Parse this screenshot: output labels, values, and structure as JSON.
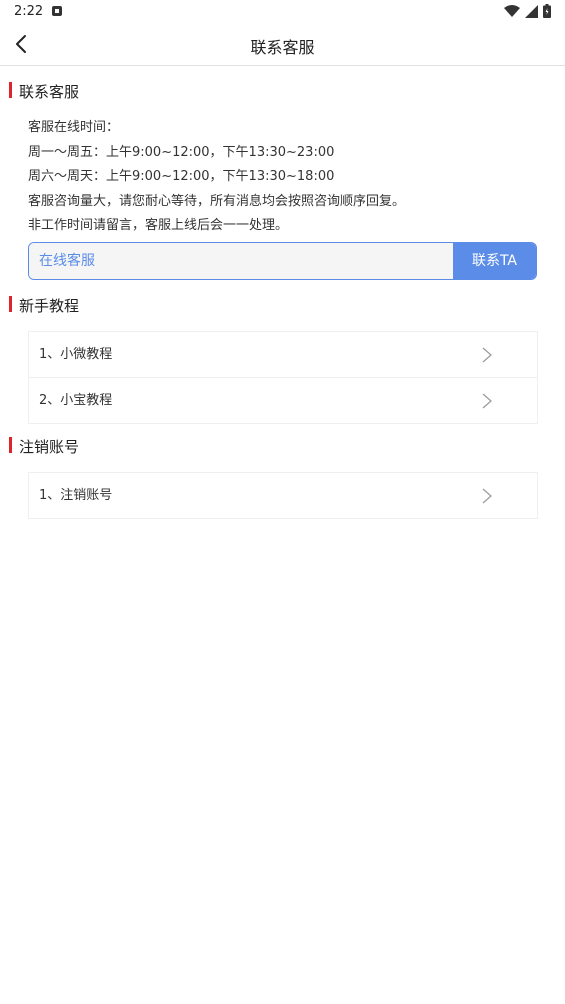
{
  "status": {
    "time": "2:22"
  },
  "nav": {
    "title": "联系客服"
  },
  "contact_section": {
    "title": "联系客服",
    "lines": [
      "客服在线时间：",
      "周一～周五：上午9:00~12:00，下午13:30~23:00",
      "周六～周天：上午9:00~12:00，下午13:30~18:00",
      "客服咨询量大，请您耐心等待，所有消息均会按照咨询顺序回复。",
      "非工作时间请留言，客服上线后会一一处理。"
    ],
    "input_value": "在线客服",
    "button_label": "联系TA"
  },
  "tutorial_section": {
    "title": "新手教程",
    "items": [
      "1、小微教程",
      "2、小宝教程"
    ]
  },
  "account_section": {
    "title": "注销账号",
    "items": [
      "1、注销账号"
    ]
  },
  "colors": {
    "accent": "#5b8de8",
    "section_bar": "#e0242c"
  }
}
